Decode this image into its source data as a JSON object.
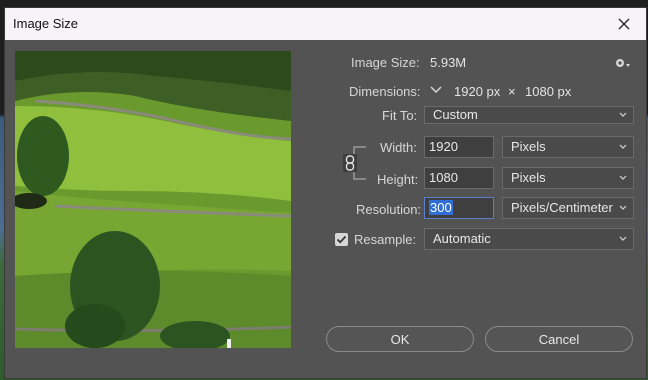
{
  "window": {
    "title": "Image Size"
  },
  "image_size": {
    "label": "Image Size:",
    "value": "5.93M"
  },
  "dimensions": {
    "label": "Dimensions:",
    "width": "1920 px",
    "times": "×",
    "height": "1080 px"
  },
  "fit_to": {
    "label": "Fit To:",
    "value": "Custom"
  },
  "width": {
    "label": "Width:",
    "value": "1920",
    "unit": "Pixels"
  },
  "height": {
    "label": "Height:",
    "value": "1080",
    "unit": "Pixels"
  },
  "resolution": {
    "label": "Resolution:",
    "value": "300",
    "unit": "Pixels/Centimeter"
  },
  "resample": {
    "label": "Resample:",
    "checked": true,
    "value": "Automatic"
  },
  "buttons": {
    "ok": "OK",
    "cancel": "Cancel"
  },
  "colors": {
    "titlebar": "#f7f3f7",
    "panel": "#535353",
    "field": "#3f3f3f",
    "selection": "#2f6fd6"
  },
  "icons": [
    "close-icon",
    "gear-icon",
    "chevron-down-icon",
    "link-icon",
    "checkmark-icon"
  ]
}
